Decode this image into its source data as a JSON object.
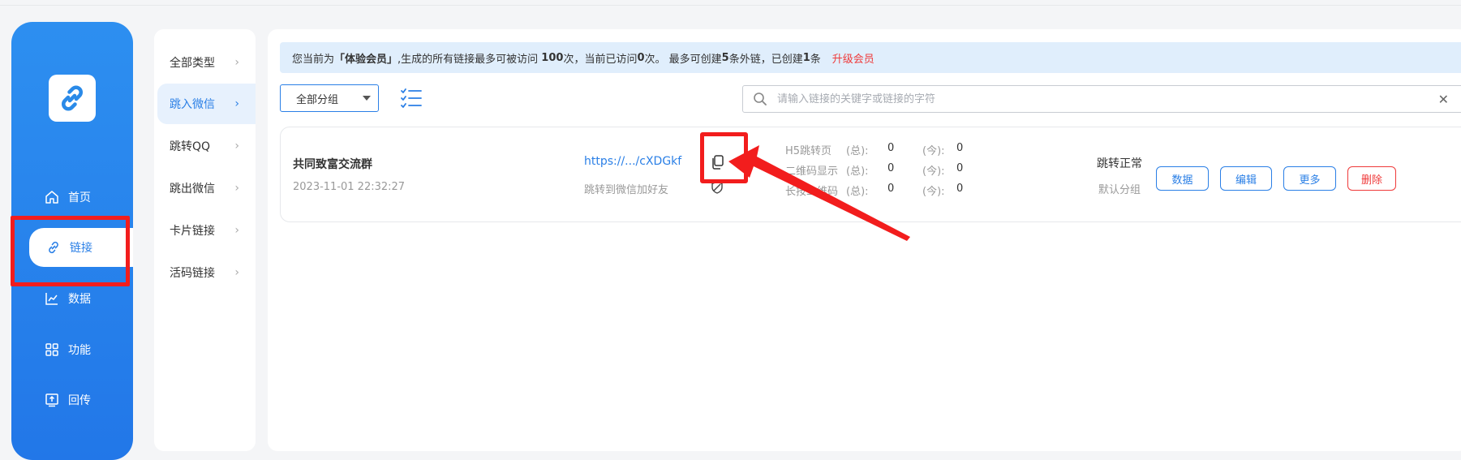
{
  "nav": {
    "items": [
      {
        "label": "首页",
        "icon": "home-icon"
      },
      {
        "label": "链接",
        "icon": "link-icon"
      },
      {
        "label": "数据",
        "icon": "chart-icon"
      },
      {
        "label": "功能",
        "icon": "grid-icon"
      },
      {
        "label": "回传",
        "icon": "upload-icon"
      }
    ],
    "active": "链接"
  },
  "subnav": {
    "items": [
      {
        "label": "全部类型"
      },
      {
        "label": "跳入微信"
      },
      {
        "label": "跳转QQ"
      },
      {
        "label": "跳出微信"
      },
      {
        "label": "卡片链接"
      },
      {
        "label": "活码链接"
      }
    ],
    "chevron": "›",
    "active": "跳入微信"
  },
  "notice": {
    "p1": "您当前为",
    "level": "「体验会员」",
    "p2": ",生成的所有链接最多可被访问 ",
    "max_visits": "100",
    "p3": "次，当前已访问",
    "visited": "0",
    "p4": "次。 最多可创建",
    "max_links": "5",
    "p5": "条外链，已创建",
    "created": "1",
    "p6": "条",
    "upgrade": "升级会员"
  },
  "toolbar": {
    "group_value": "全部分组",
    "search_placeholder": "请输入链接的关键字或链接的字符",
    "clear": "✕"
  },
  "card": {
    "title": "共同致富交流群",
    "date": "2023-11-01 22:32:27",
    "link": "https://.../cXDGkf",
    "desc": "跳转到微信加好友",
    "stats": [
      {
        "label": "H5跳转页",
        "total_label": "(总):",
        "total": "0",
        "today_label": "(今):",
        "today": "0"
      },
      {
        "label": "二维码显示",
        "total_label": "(总):",
        "total": "0",
        "today_label": "(今):",
        "today": "0"
      },
      {
        "label": "长按二维码",
        "total_label": "(总):",
        "total": "0",
        "today_label": "(今):",
        "today": "0"
      }
    ],
    "status": "跳转正常",
    "group": "默认分组",
    "buttons": {
      "data": "数据",
      "edit": "编辑",
      "more": "更多",
      "delete": "删除"
    }
  },
  "colors": {
    "primary": "#2a7fe6",
    "nav_bg": "#2d8ff0",
    "highlight_red": "#f21d1d",
    "notice_bg": "#e0eefc",
    "upgrade_red": "#ef3a3a"
  }
}
